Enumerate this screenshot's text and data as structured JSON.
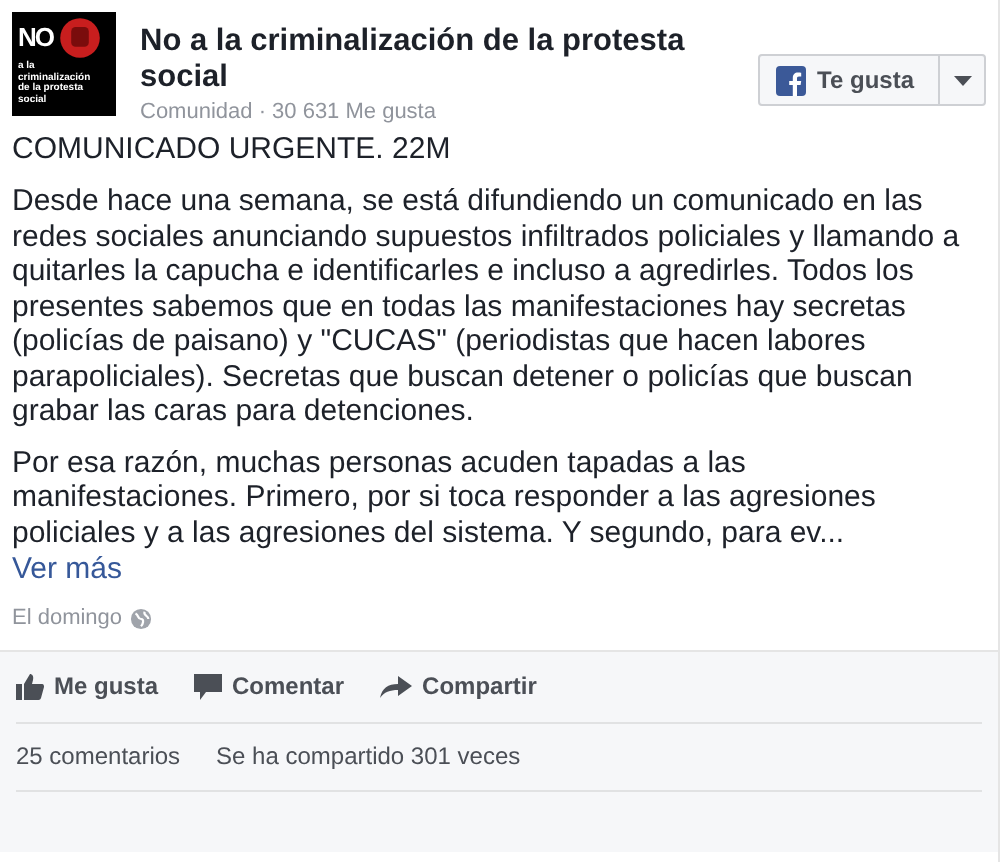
{
  "page": {
    "logo_title": "NO",
    "logo_subtitle": "a la criminalización de la protesta social",
    "name": "No a la criminalización de la protesta social",
    "meta": "Comunidad · 30 631 Me gusta"
  },
  "like_button": {
    "label": "Te gusta"
  },
  "post": {
    "headline": "COMUNICADO URGENTE. 22M",
    "paragraphs": [
      "Desde hace una semana, se está difundiendo un comunicado en las redes sociales anunciando supuestos infiltrados policiales y llamando a quitarles la capucha e identificarles e incluso a agredirles. Todos los presentes sabemos que en todas las manifestaciones hay secretas (policías de paisano) y \"CUCAS\" (periodistas que hacen labores parapoliciales). Secretas que buscan detener o policías que buscan grabar las caras para detenciones.",
      "Por esa razón, muchas personas acuden tapadas a las manifestaciones. Primero, por si toca responder a las agresiones policiales y a las agresiones del sistema. Y segundo, para ev..."
    ],
    "more": "Ver más",
    "time": "El domingo"
  },
  "actions": [
    {
      "kind": "like",
      "label": "Me gusta"
    },
    {
      "kind": "comment",
      "label": "Comentar"
    },
    {
      "kind": "share",
      "label": "Compartir"
    }
  ],
  "stats": [
    "25 comentarios",
    "Se ha compartido 301 veces"
  ]
}
